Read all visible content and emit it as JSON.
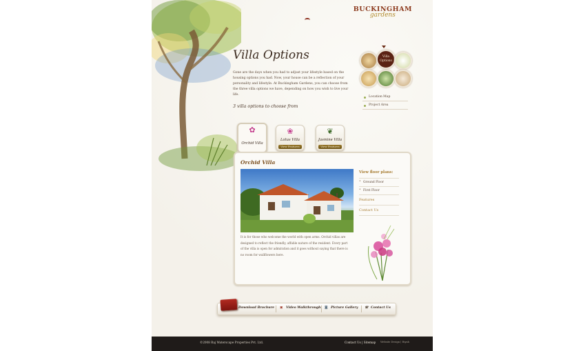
{
  "brand": {
    "name_line1": "BUCKINGHAM",
    "name_line2": "gardens"
  },
  "page_title": "Villa Options",
  "intro": "Gone are the days when you had to adjust your lifestyle based on the housing options you had. Now, your house can be a reflection of your personality and lifestyle. At Buckingham Gardens, you can choose from the three villa options we have, depending on how you wish to live your life.",
  "subhead": "3 villa options to choose from",
  "circle_nav": {
    "active_label": "Villa Options"
  },
  "side_links": [
    "Location Map",
    "Project Area"
  ],
  "tabs": [
    {
      "label": "Orchid Villa",
      "button": ""
    },
    {
      "label": "Lotus Villa",
      "button": "View Features"
    },
    {
      "label": "Jasmine Villa",
      "button": "View Features"
    }
  ],
  "panel": {
    "title": "Orchid Villa",
    "description": "It is for those who welcome the world with open arms. Orchid villas are designed to reflect the friendly, affable nature of the resident. Every part of the villa is open for admiration and it goes without saying that there is no room for wallflowers here.",
    "floor_plans_label": "View floor plans:",
    "floor_plans": [
      "Ground Floor",
      "First Floor"
    ],
    "links": [
      "Features",
      "Contact Us"
    ]
  },
  "bottom_bar": [
    "Download Brochure",
    "Video Walkthrough",
    "Picture Gallery",
    "Contact Us"
  ],
  "footer": {
    "copyright": "©2008  Raj Waterscape Properties Pvt. Ltd.",
    "links": [
      "Contact Us",
      "Sitemap"
    ],
    "credit": "Website Design  |  Riyah"
  },
  "colors": {
    "brand": "#8c3a1d",
    "accent": "#a5792c",
    "footer": "#1f1b19"
  }
}
